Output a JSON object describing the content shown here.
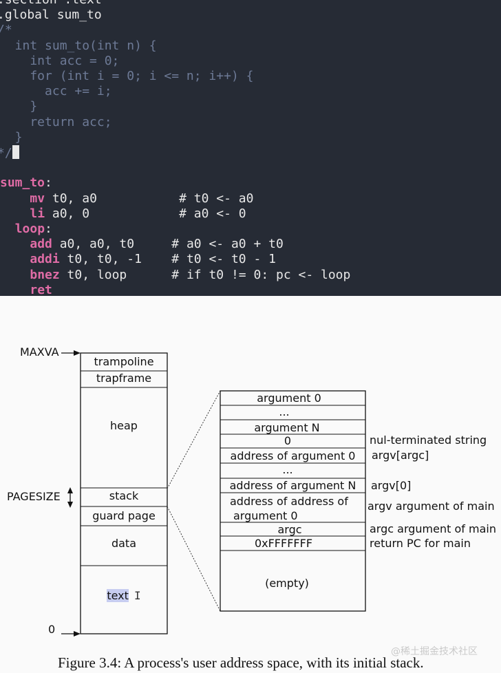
{
  "code": {
    "lines": [
      [
        {
          "t": ".section .text"
        }
      ],
      [
        {
          "t": ".global sum_to"
        }
      ],
      [
        {
          "t": "/*",
          "c": "cm"
        }
      ],
      [
        {
          "t": "  int sum_to(int n) {",
          "c": "cm"
        }
      ],
      [
        {
          "t": "    int acc = 0;",
          "c": "cm"
        }
      ],
      [
        {
          "t": "    for (int i = 0; i <= n; i++) {",
          "c": "cm"
        }
      ],
      [
        {
          "t": "      acc += i;",
          "c": "cm"
        }
      ],
      [
        {
          "t": "    }",
          "c": "cm"
        }
      ],
      [
        {
          "t": "    return acc;",
          "c": "cm"
        }
      ],
      [
        {
          "t": "  }",
          "c": "cm"
        }
      ],
      [
        {
          "t": "*/",
          "c": "cm"
        }
      ],
      [],
      [
        {
          "t": "sum_to",
          "c": "kw"
        },
        {
          "t": ":"
        }
      ],
      [
        {
          "t": "    "
        },
        {
          "t": "mv",
          "c": "kw"
        },
        {
          "t": " t0, a0           # t0 <- a0"
        }
      ],
      [
        {
          "t": "    "
        },
        {
          "t": "li",
          "c": "kw"
        },
        {
          "t": " a0, 0            # a0 <- 0"
        }
      ],
      [
        {
          "t": "  "
        },
        {
          "t": "loop",
          "c": "kw"
        },
        {
          "t": ":"
        }
      ],
      [
        {
          "t": "    "
        },
        {
          "t": "add",
          "c": "kw"
        },
        {
          "t": " a0, a0, t0     # a0 <- a0 + t0"
        }
      ],
      [
        {
          "t": "    "
        },
        {
          "t": "addi",
          "c": "kw"
        },
        {
          "t": " t0, t0, -1    # t0 <- t0 - 1"
        }
      ],
      [
        {
          "t": "    "
        },
        {
          "t": "bnez",
          "c": "kw"
        },
        {
          "t": " t0, loop      # if t0 != 0: pc <- loop"
        }
      ],
      [
        {
          "t": "    "
        },
        {
          "t": "ret",
          "c": "kw"
        }
      ]
    ]
  },
  "diagram": {
    "maxva_label": "MAXVA",
    "pagesize_label": "PAGESIZE",
    "zero_label": "0",
    "left_stack": {
      "trampoline": "trampoline",
      "trapframe": "trapframe",
      "heap": "heap",
      "stack": "stack",
      "guard_page": "guard page",
      "data": "data",
      "text": "text"
    },
    "right_stack": {
      "argument_0": "argument 0",
      "dots_1": "...",
      "argument_n": "argument N",
      "zero": "0",
      "addr_arg_0": "address of argument 0",
      "dots_2": "...",
      "addr_arg_n": "address of argument N",
      "addr_addr_1": "address of address of",
      "addr_addr_2": "argument 0",
      "argc": "argc",
      "return_pc": "0xFFFFFFF",
      "empty": "(empty)"
    },
    "annotations": {
      "nul": "nul-terminated string",
      "argv_argc": "argv[argc]",
      "argv_0": "argv[0]",
      "argv_arg": "argv argument of main",
      "argc_arg": "argc argument of main",
      "return_pc": "return PC for main"
    }
  },
  "caption": "Figure 3.4: A process's user address space, with its initial stack.",
  "watermark": "@稀土掘金技术社区"
}
